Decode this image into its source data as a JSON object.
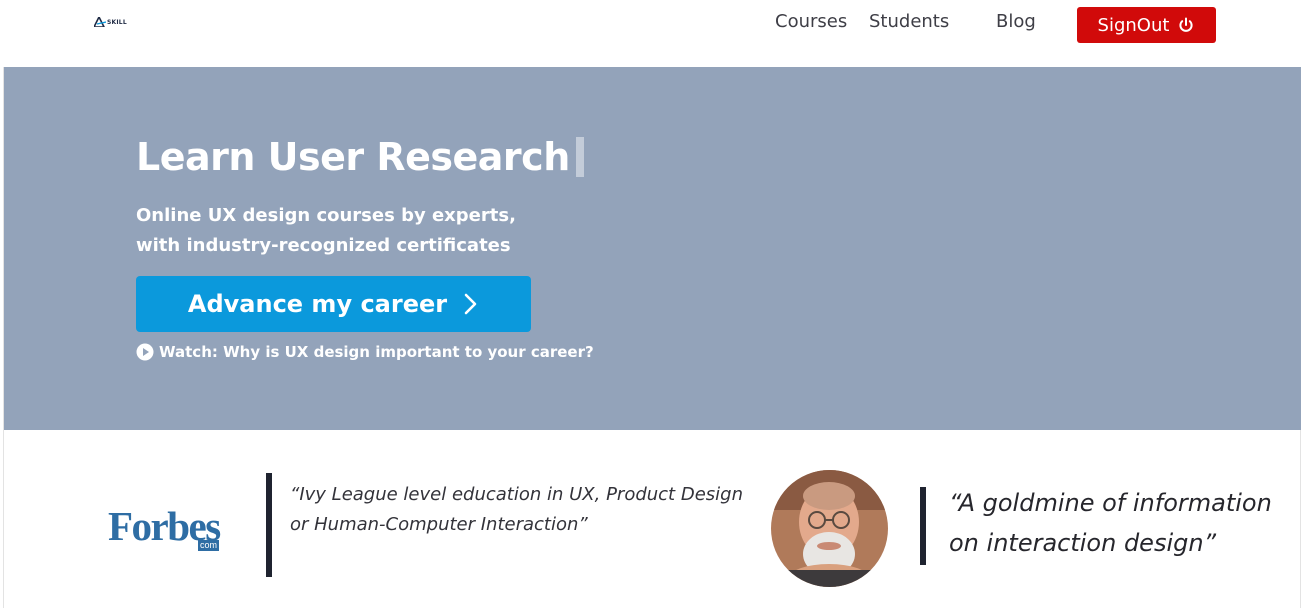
{
  "header": {
    "logo_text": "SKILL",
    "nav": {
      "courses": "Courses",
      "students": "Students",
      "blog": "Blog"
    },
    "signout_label": "SignOut",
    "signout_icon": "power-icon",
    "signout_color": "#d10a0a"
  },
  "hero": {
    "background": "#93a3ba",
    "title": "Learn User Research",
    "subtitle": "Online UX design courses by experts, with industry-recognized certificates",
    "cta_label": "Advance my career",
    "cta_icon": "chevron-right-icon",
    "cta_color": "#0b99dc",
    "watch_label": "Watch: Why is UX design important to your career?",
    "watch_icon": "play-circle-icon"
  },
  "testimonials": [
    {
      "source": "Forbes",
      "source_suffix": "com",
      "quote": "“Ivy League level education in UX, Product Design or Human-Computer Interaction”"
    },
    {
      "avatar": "portrait-photo",
      "quote": "“A goldmine of information on interaction design”"
    }
  ]
}
